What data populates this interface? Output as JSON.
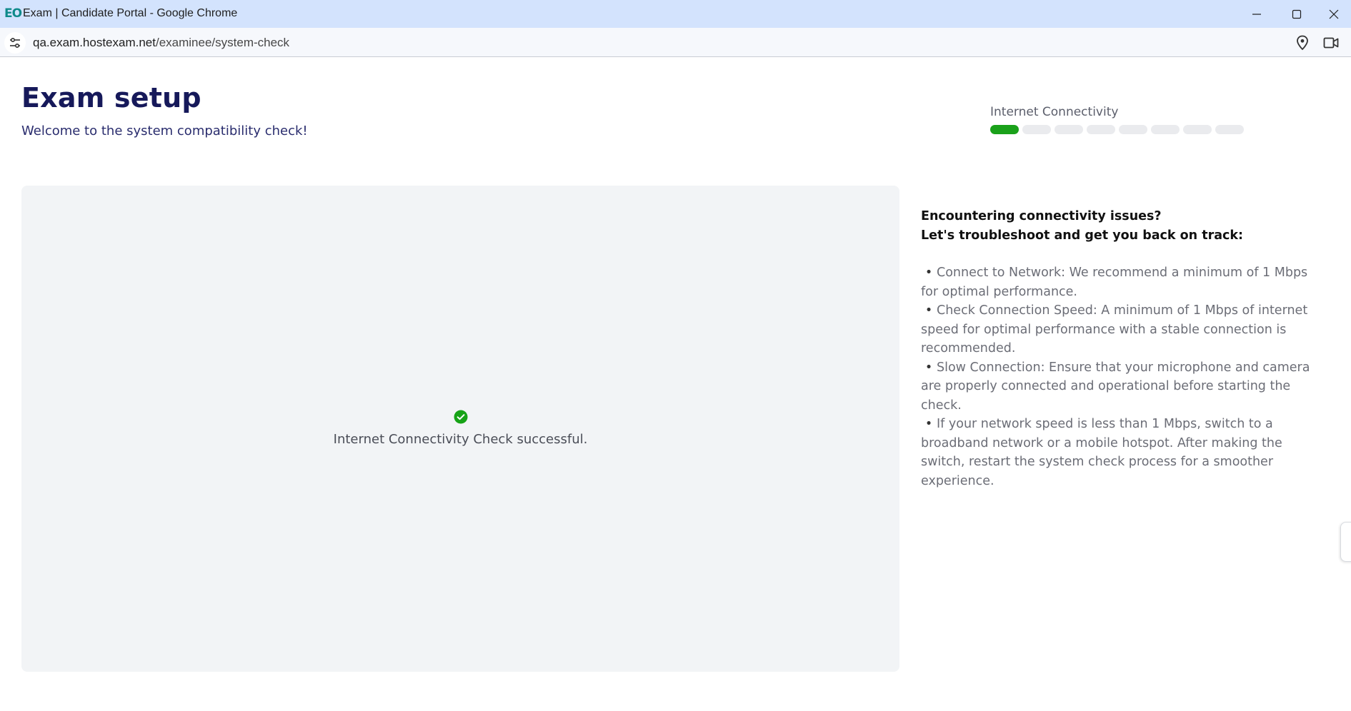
{
  "browser": {
    "app_logo_text": "EO",
    "window_title": "Exam | Candidate Portal - Google Chrome",
    "url_host": "qa.exam.hostexam.net",
    "url_path": "/examinee/system-check"
  },
  "header": {
    "title": "Exam setup",
    "subtitle": "Welcome to the system compatibility check!"
  },
  "progress": {
    "label": "Internet Connectivity",
    "total_steps": 8,
    "completed_steps": 1,
    "active_color": "#1aa11a"
  },
  "check": {
    "status_icon": "check-circle-icon",
    "message": "Internet Connectivity Check successful."
  },
  "help": {
    "heading_line1": "Encountering connectivity issues?",
    "heading_line2": "Let's troubleshoot and get you back on track:",
    "items": [
      "Connect to Network: We recommend a minimum of 1 Mbps for optimal performance.",
      "Check Connection Speed: A minimum of 1 Mbps of internet speed for optimal performance with a stable connection is recommended.",
      "Slow Connection: Ensure that your microphone and camera are properly connected and operational before starting the check.",
      "If your network speed is less than 1 Mbps, switch to a broadband network or a mobile hotspot. After making the switch, restart the system check process for a smoother experience."
    ]
  },
  "icons": {
    "minimize": "minimize-icon",
    "maximize": "maximize-icon",
    "close": "close-icon",
    "site_info": "tune-icon",
    "location": "location-pin-icon",
    "camera": "video-camera-icon"
  }
}
